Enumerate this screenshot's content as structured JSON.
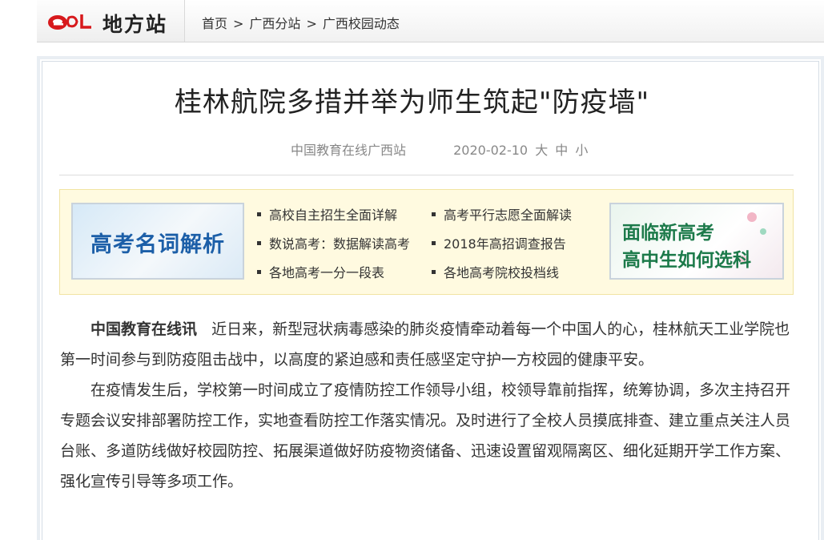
{
  "header": {
    "logo_text": "地方站",
    "breadcrumb": [
      "首页",
      "广西分站",
      "广西校园动态"
    ],
    "separator": ">"
  },
  "article": {
    "title": "桂林航院多措并举为师生筑起\"防疫墙\"",
    "source": "中国教育在线广西站",
    "date": "2020-02-10",
    "font_sizes": [
      "大",
      "中",
      "小"
    ],
    "lead_source": "中国教育在线讯",
    "paragraph1": "近日来，新型冠状病毒感染的肺炎疫情牵动着每一个中国人的心，桂林航天工业学院也第一时间参与到防疫阻击战中，以高度的紧迫感和责任感坚定守护一方校园的健康平安。",
    "paragraph2": "在疫情发生后，学校第一时间成立了疫情防控工作领导小组，校领导靠前指挥，统筹协调，多次主持召开专题会议安排部署防控工作，实地查看防控工作落实情况。及时进行了全校人员摸底排查、建立重点关注人员台账、多道防线做好校园防控、拓展渠道做好防疫物资储备、迅速设置留观隔离区、细化延期开学工作方案、强化宣传引导等多项工作。"
  },
  "promo": {
    "left_banner": "高考名词解析",
    "right_banner_line1": "面临新高考",
    "right_banner_line2": "高中生如何选科",
    "links_col1": [
      "高校自主招生全面详解",
      "数说高考：数据解读高考",
      "各地高考一分一段表"
    ],
    "links_col2": [
      "高考平行志愿全面解读",
      "2018年高招调查报告",
      "各地高考院校投档线"
    ]
  },
  "colors": {
    "logo_red": "#d7191c",
    "promo_bg": "#fffae0",
    "banner_blue": "#1c5fa8",
    "banner_green": "#1c7a4a"
  }
}
